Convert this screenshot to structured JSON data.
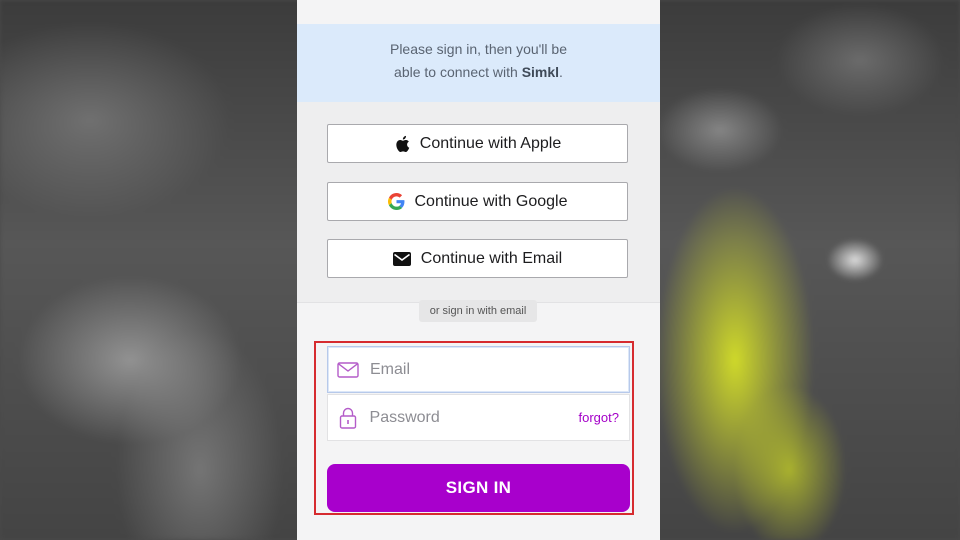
{
  "notice": {
    "line1": "Please sign in, then you'll be",
    "line2_prefix": "able to connect with ",
    "brand": "Simkl",
    "line2_suffix": "."
  },
  "providers": [
    {
      "label": "Continue with Apple",
      "icon": "apple-icon"
    },
    {
      "label": "Continue with Google",
      "icon": "google-icon"
    },
    {
      "label": "Continue with Email",
      "icon": "envelope-icon"
    }
  ],
  "divider": "or sign in with email",
  "form": {
    "email_placeholder": "Email",
    "password_placeholder": "Password",
    "forgot_label": "forgot?",
    "submit_label": "SIGN IN"
  },
  "colors": {
    "accent": "#a800cc",
    "highlight_border": "#d62b2f",
    "notice_bg": "#dbeafb"
  }
}
